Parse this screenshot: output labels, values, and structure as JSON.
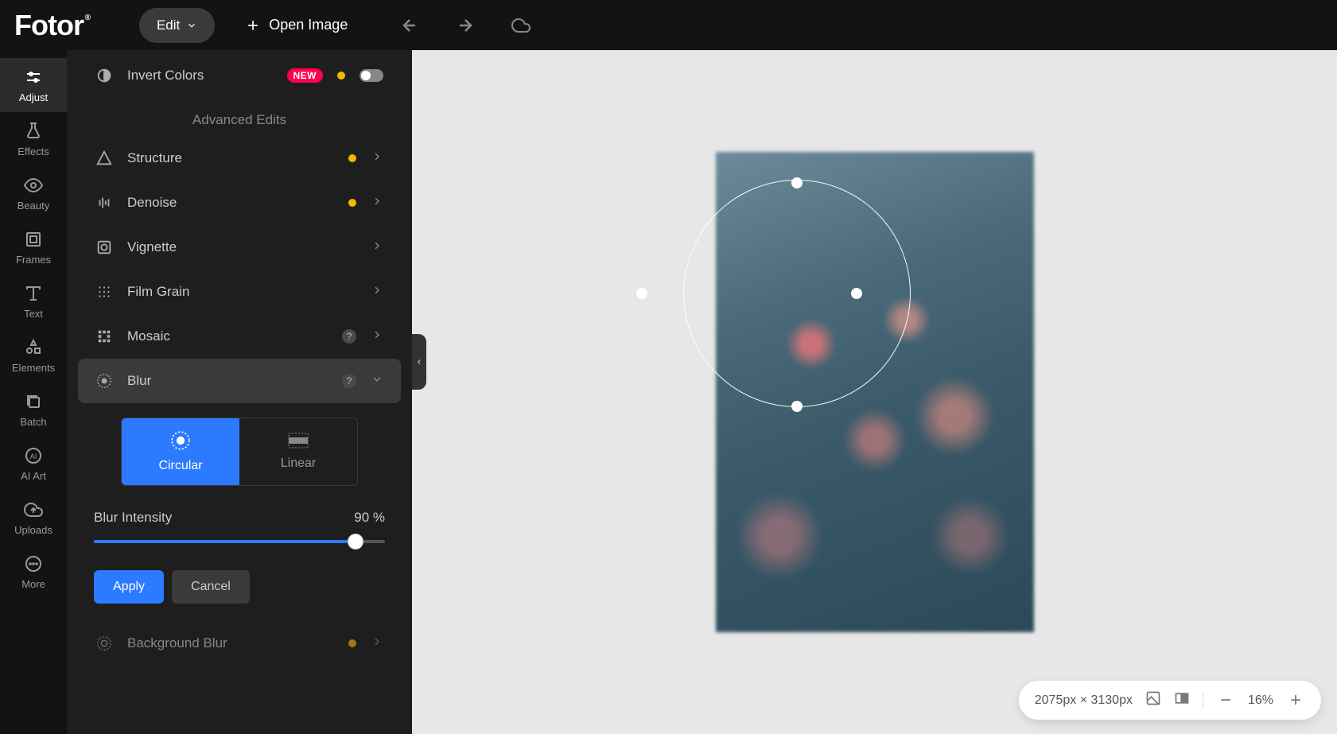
{
  "topbar": {
    "edit": "Edit",
    "open_image": "Open Image"
  },
  "rail": [
    {
      "id": "adjust",
      "label": "Adjust"
    },
    {
      "id": "effects",
      "label": "Effects"
    },
    {
      "id": "beauty",
      "label": "Beauty"
    },
    {
      "id": "frames",
      "label": "Frames"
    },
    {
      "id": "text",
      "label": "Text"
    },
    {
      "id": "elements",
      "label": "Elements"
    },
    {
      "id": "batch",
      "label": "Batch"
    },
    {
      "id": "aiart",
      "label": "AI Art"
    },
    {
      "id": "uploads",
      "label": "Uploads"
    },
    {
      "id": "more",
      "label": "More"
    }
  ],
  "panel": {
    "invert_colors": "Invert Colors",
    "new_badge": "NEW",
    "section_advanced": "Advanced Edits",
    "structure": "Structure",
    "denoise": "Denoise",
    "vignette": "Vignette",
    "film_grain": "Film Grain",
    "mosaic": "Mosaic",
    "blur": "Blur",
    "blur_tab_circular": "Circular",
    "blur_tab_linear": "Linear",
    "blur_intensity_label": "Blur Intensity",
    "blur_intensity_value": "90 %",
    "blur_intensity_pct": 90,
    "apply": "Apply",
    "cancel": "Cancel",
    "background_blur": "Background Blur"
  },
  "status": {
    "dimensions": "2075px × 3130px",
    "zoom": "16%"
  }
}
